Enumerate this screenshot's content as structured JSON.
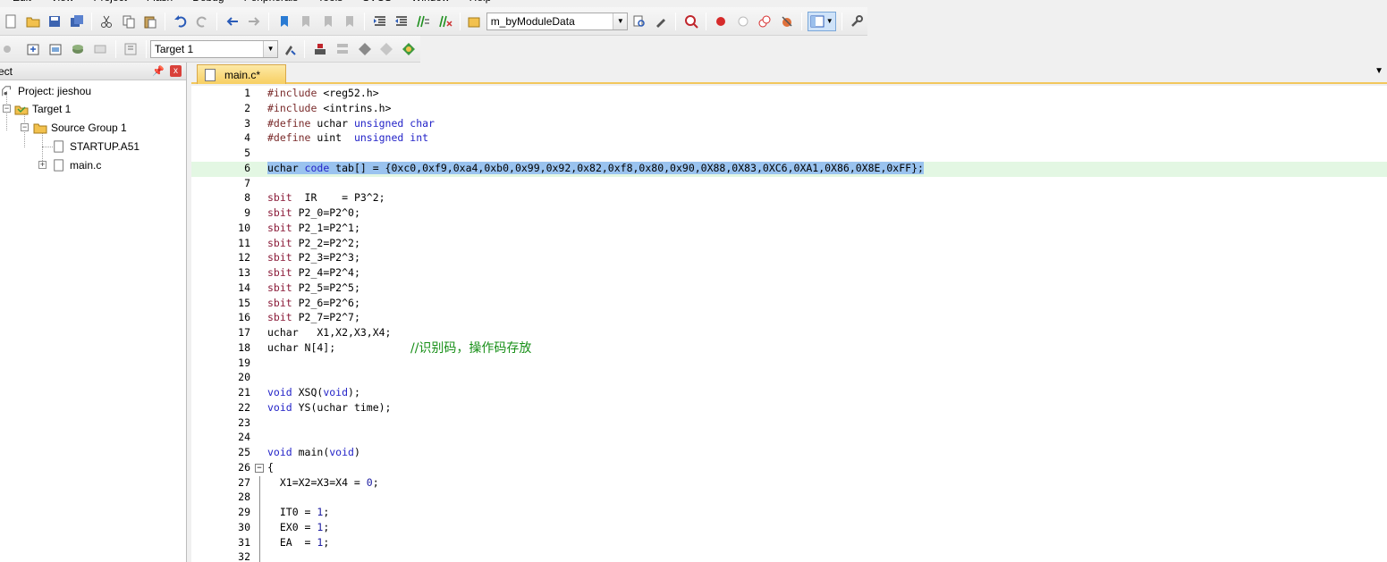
{
  "menu": [
    "Edit",
    "View",
    "Project",
    "Flash",
    "Debug",
    "Peripherals",
    "Tools",
    "SVCS",
    "Window",
    "Help"
  ],
  "toolbar": {
    "function_combo": "m_byModuleData",
    "target_combo": "Target 1"
  },
  "project_panel": {
    "title": "ect",
    "pin": "⌘",
    "close": "x",
    "tree": [
      {
        "label": "Project: jieshou"
      },
      {
        "label": "Target 1"
      },
      {
        "label": "Source Group 1"
      },
      {
        "label": "STARTUP.A51"
      },
      {
        "label": "main.c"
      }
    ]
  },
  "editor": {
    "tab_label": "main.c*",
    "lines": [
      {
        "n": "1",
        "code": "#include <reg52.h>"
      },
      {
        "n": "2",
        "code": "#include <intrins.h>"
      },
      {
        "n": "3",
        "code": "#define uchar unsigned char"
      },
      {
        "n": "4",
        "code": "#define uint  unsigned int"
      },
      {
        "n": "5",
        "code": ""
      },
      {
        "n": "6",
        "code": "uchar code tab[] = {0xc0,0xf9,0xa4,0xb0,0x99,0x92,0x82,0xf8,0x80,0x90,0X88,0X83,0XC6,0XA1,0X86,0X8E,0xFF};"
      },
      {
        "n": "7",
        "code": ""
      },
      {
        "n": "8",
        "code": "sbit  IR    = P3^2;"
      },
      {
        "n": "9",
        "code": "sbit P2_0=P2^0;"
      },
      {
        "n": "10",
        "code": "sbit P2_1=P2^1;"
      },
      {
        "n": "11",
        "code": "sbit P2_2=P2^2;"
      },
      {
        "n": "12",
        "code": "sbit P2_3=P2^3;"
      },
      {
        "n": "13",
        "code": "sbit P2_4=P2^4;"
      },
      {
        "n": "14",
        "code": "sbit P2_5=P2^5;"
      },
      {
        "n": "15",
        "code": "sbit P2_6=P2^6;"
      },
      {
        "n": "16",
        "code": "sbit P2_7=P2^7;"
      },
      {
        "n": "17",
        "code": "uchar   X1,X2,X3,X4;"
      },
      {
        "n": "18",
        "code": "uchar N[4];",
        "comment": "//识别码，操作码存放"
      },
      {
        "n": "19",
        "code": ""
      },
      {
        "n": "20",
        "code": ""
      },
      {
        "n": "21",
        "code": "void XSQ(void);"
      },
      {
        "n": "22",
        "code": "void YS(uchar time);"
      },
      {
        "n": "23",
        "code": ""
      },
      {
        "n": "24",
        "code": ""
      },
      {
        "n": "25",
        "code": "void main(void)"
      },
      {
        "n": "26",
        "code": "{"
      },
      {
        "n": "27",
        "code": "  X1=X2=X3=X4 = 0;"
      },
      {
        "n": "28",
        "code": ""
      },
      {
        "n": "29",
        "code": "  IT0 = 1;"
      },
      {
        "n": "30",
        "code": "  EX0 = 1;"
      },
      {
        "n": "31",
        "code": "  EA  = 1;"
      },
      {
        "n": "32",
        "code": ""
      }
    ]
  },
  "colors": {
    "tab_active": "#f7cf62",
    "selection": "#9ac3ef",
    "current_line": "#e3f7e3",
    "keyword": "#2323c8",
    "comment": "#178f17"
  }
}
